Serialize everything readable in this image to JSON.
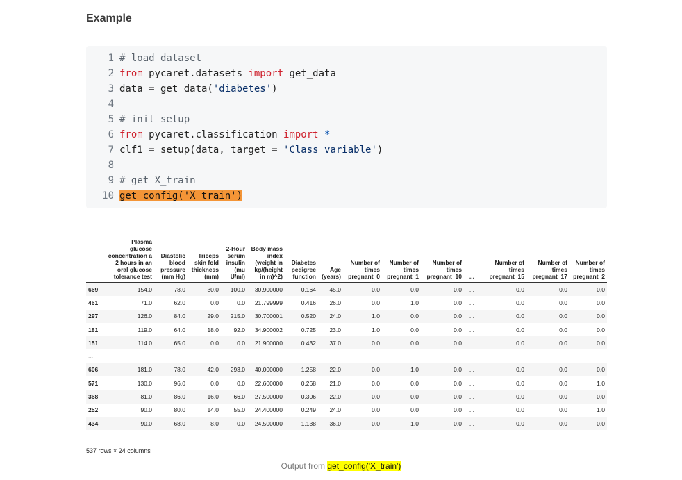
{
  "heading": "Example",
  "code": {
    "lines": [
      {
        "num": "1",
        "parts": [
          {
            "t": "# load dataset",
            "c": "cm"
          }
        ]
      },
      {
        "num": "2",
        "parts": [
          {
            "t": "from",
            "c": "kw"
          },
          {
            "t": " pycaret.datasets ",
            "c": ""
          },
          {
            "t": "import",
            "c": "kw"
          },
          {
            "t": " get_data",
            "c": ""
          }
        ]
      },
      {
        "num": "3",
        "parts": [
          {
            "t": "data = get_data(",
            "c": ""
          },
          {
            "t": "'diabetes'",
            "c": "st"
          },
          {
            "t": ")",
            "c": ""
          }
        ]
      },
      {
        "num": "4",
        "parts": []
      },
      {
        "num": "5",
        "parts": [
          {
            "t": "# init setup",
            "c": "cm"
          }
        ]
      },
      {
        "num": "6",
        "parts": [
          {
            "t": "from",
            "c": "kw"
          },
          {
            "t": " pycaret.classification ",
            "c": ""
          },
          {
            "t": "import",
            "c": "kw"
          },
          {
            "t": " ",
            "c": ""
          },
          {
            "t": "*",
            "c": "op"
          }
        ]
      },
      {
        "num": "7",
        "parts": [
          {
            "t": "clf1 = setup(data, target = ",
            "c": ""
          },
          {
            "t": "'Class variable'",
            "c": "st"
          },
          {
            "t": ")",
            "c": ""
          }
        ]
      },
      {
        "num": "8",
        "parts": []
      },
      {
        "num": "9",
        "parts": [
          {
            "t": "# get X_train",
            "c": "cm"
          }
        ]
      },
      {
        "num": "10",
        "parts": [
          {
            "t": "get_config('X_train')",
            "c": "hl"
          }
        ]
      }
    ]
  },
  "table": {
    "headers": [
      "",
      "Plasma glucose concentration a 2 hours in an oral glucose tolerance test",
      "Diastolic blood pressure (mm Hg)",
      "Triceps skin fold thickness (mm)",
      "2-Hour serum insulin (mu U/ml)",
      "Body mass index (weight in kg/(height in m)^2)",
      "Diabetes pedigree function",
      "Age (years)",
      "Number of times pregnant_0",
      "Number of times pregnant_1",
      "Number of times pregnant_10",
      "...",
      "Number of times pregnant_15",
      "Number of times pregnant_17",
      "Number of times pregnant_2"
    ],
    "rows": [
      [
        "669",
        "154.0",
        "78.0",
        "30.0",
        "100.0",
        "30.900000",
        "0.164",
        "45.0",
        "0.0",
        "0.0",
        "0.0",
        "...",
        "0.0",
        "0.0",
        "0.0"
      ],
      [
        "461",
        "71.0",
        "62.0",
        "0.0",
        "0.0",
        "21.799999",
        "0.416",
        "26.0",
        "0.0",
        "1.0",
        "0.0",
        "...",
        "0.0",
        "0.0",
        "0.0"
      ],
      [
        "297",
        "126.0",
        "84.0",
        "29.0",
        "215.0",
        "30.700001",
        "0.520",
        "24.0",
        "1.0",
        "0.0",
        "0.0",
        "...",
        "0.0",
        "0.0",
        "0.0"
      ],
      [
        "181",
        "119.0",
        "64.0",
        "18.0",
        "92.0",
        "34.900002",
        "0.725",
        "23.0",
        "1.0",
        "0.0",
        "0.0",
        "...",
        "0.0",
        "0.0",
        "0.0"
      ],
      [
        "151",
        "114.0",
        "65.0",
        "0.0",
        "0.0",
        "21.900000",
        "0.432",
        "37.0",
        "0.0",
        "0.0",
        "0.0",
        "...",
        "0.0",
        "0.0",
        "0.0"
      ],
      [
        "...",
        "...",
        "...",
        "...",
        "...",
        "...",
        "...",
        "...",
        "...",
        "...",
        "...",
        "...",
        "...",
        "...",
        "..."
      ],
      [
        "606",
        "181.0",
        "78.0",
        "42.0",
        "293.0",
        "40.000000",
        "1.258",
        "22.0",
        "0.0",
        "1.0",
        "0.0",
        "...",
        "0.0",
        "0.0",
        "0.0"
      ],
      [
        "571",
        "130.0",
        "96.0",
        "0.0",
        "0.0",
        "22.600000",
        "0.268",
        "21.0",
        "0.0",
        "0.0",
        "0.0",
        "...",
        "0.0",
        "0.0",
        "1.0"
      ],
      [
        "368",
        "81.0",
        "86.0",
        "16.0",
        "66.0",
        "27.500000",
        "0.306",
        "22.0",
        "0.0",
        "0.0",
        "0.0",
        "...",
        "0.0",
        "0.0",
        "0.0"
      ],
      [
        "252",
        "90.0",
        "80.0",
        "14.0",
        "55.0",
        "24.400000",
        "0.249",
        "24.0",
        "0.0",
        "0.0",
        "0.0",
        "...",
        "0.0",
        "0.0",
        "1.0"
      ],
      [
        "434",
        "90.0",
        "68.0",
        "8.0",
        "0.0",
        "24.500000",
        "1.138",
        "36.0",
        "0.0",
        "1.0",
        "0.0",
        "...",
        "0.0",
        "0.0",
        "0.0"
      ]
    ]
  },
  "footer_note": "537 rows × 24 columns",
  "caption": {
    "prefix": "Output from ",
    "highlight": "get_config('X_train')"
  }
}
